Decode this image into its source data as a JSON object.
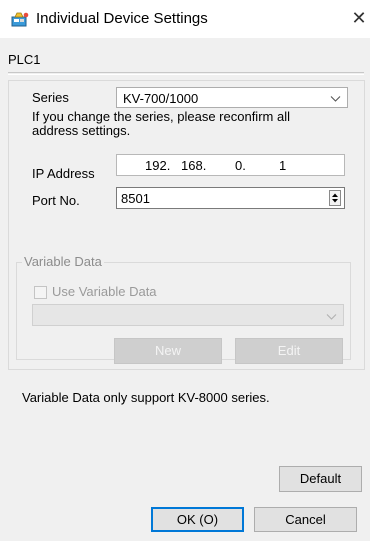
{
  "window": {
    "title": "Individual Device Settings",
    "close_glyph": "✕"
  },
  "device": {
    "name": "PLC1"
  },
  "form": {
    "series_label": "Series",
    "series_value": "KV-700/1000",
    "series_note": "If you change the series, please reconfirm all address settings.",
    "ip_label": "IP Address",
    "ip_parts": [
      "192.",
      "168.",
      "0.",
      "1"
    ],
    "port_label": "Port No.",
    "port_value": "8501"
  },
  "variable_data": {
    "group_title": "Variable Data",
    "checkbox_label": "Use Variable Data",
    "checked": false,
    "select_value": "",
    "new_label": "New",
    "edit_label": "Edit",
    "enabled": false
  },
  "note": "Variable Data only support KV-8000 series.",
  "buttons": {
    "default_label": "Default",
    "ok_label": "OK (O)",
    "cancel_label": "Cancel"
  },
  "icons": {
    "app": "device-settings-icon",
    "close": "close-icon",
    "dropdown": "chevron-down-icon",
    "spinner": "spinner-arrows-icon"
  },
  "colors": {
    "window_bg": "#f0f0f0",
    "titlebar_bg": "#ffffff",
    "focus_border": "#0078d7",
    "disabled_button": "#cfcfcf"
  }
}
